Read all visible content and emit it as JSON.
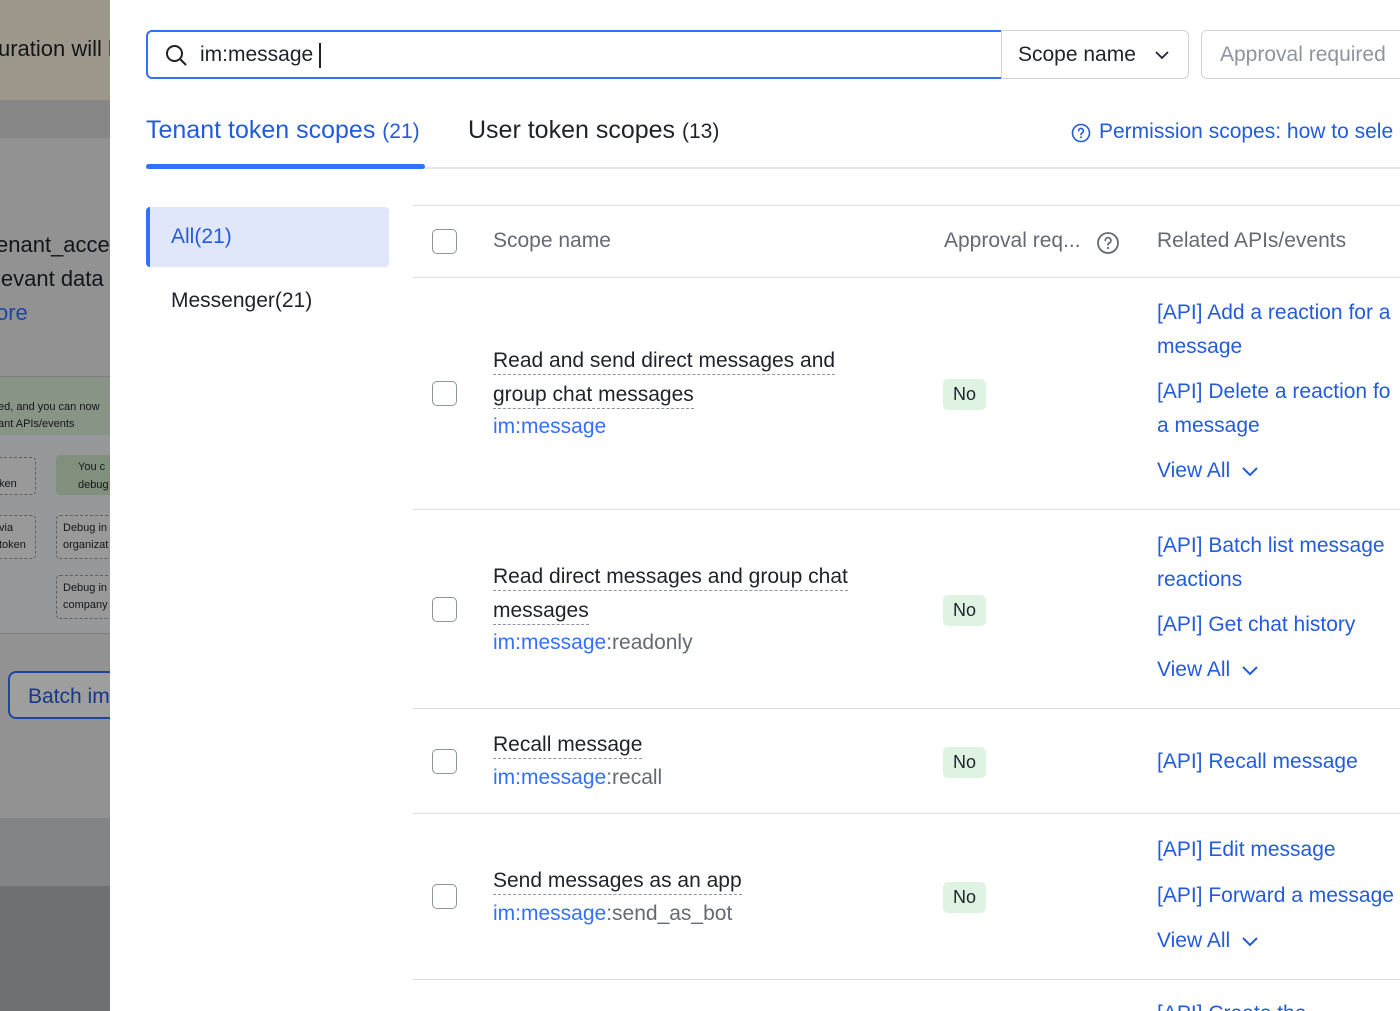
{
  "background": {
    "banner_text": "uration will b",
    "para_line1": "enant_acce",
    "para_line2": "levant data",
    "para_link": "ore",
    "diagram_note1": "ed, and you can now",
    "diagram_note2": "ant APIs/events",
    "diagram_box1": "ken",
    "diagram_box2a": "via",
    "diagram_box2b": "token",
    "diagram_box3a": "Debug in",
    "diagram_box3b": "organizat",
    "diagram_box4a": "Debug in",
    "diagram_box4b": "company",
    "diagram_green_a": "You c",
    "diagram_green_b": "debug",
    "batch_button": "Batch im"
  },
  "search": {
    "value": "im:message",
    "scope_filter": "Scope name",
    "approval_filter": "Approval required"
  },
  "tabs": {
    "tenant_label": "Tenant token scopes",
    "tenant_count": "(21)",
    "user_label": "User token scopes",
    "user_count": "(13)",
    "help_link": "Permission scopes: how to sele"
  },
  "categories": [
    {
      "label": "All(21)",
      "active": true
    },
    {
      "label": "Messenger(21)",
      "active": false
    }
  ],
  "table": {
    "headers": {
      "scope_name": "Scope name",
      "approval": "Approval req...",
      "related": "Related APIs/events"
    },
    "rows": [
      {
        "title_line1": "Read and send direct messages and",
        "title_line2": "group chat messages",
        "key_highlight": "im:message",
        "key_rest": "",
        "approval": "No",
        "apis": [
          "[API] Add a reaction for a",
          "message",
          "[API] Delete a reaction fo",
          "a message"
        ],
        "view_all": "View All"
      },
      {
        "title_line1": "Read direct messages and group chat",
        "title_line2": "messages",
        "key_highlight": "im:message",
        "key_rest": ":readonly",
        "approval": "No",
        "apis": [
          "[API] Batch list message",
          "reactions",
          "[API] Get chat history"
        ],
        "view_all": "View All"
      },
      {
        "title_line1": "Recall message",
        "key_highlight": "im:message",
        "key_rest": ":recall",
        "approval": "No",
        "apis": [
          "[API] Recall message"
        ]
      },
      {
        "title_line1": "Send messages as an app",
        "key_highlight": "im:message",
        "key_rest": ":send_as_bot",
        "approval": "No",
        "apis": [
          "[API] Edit message",
          "[API] Forward a message"
        ],
        "view_all": "View All"
      }
    ],
    "partial_next_api": "[API] Create the ..."
  },
  "colors": {
    "accent": "#3370ff",
    "link": "#245bdb",
    "badge_bg": "#dff3e2",
    "active_category_bg": "#e1e7fb"
  }
}
